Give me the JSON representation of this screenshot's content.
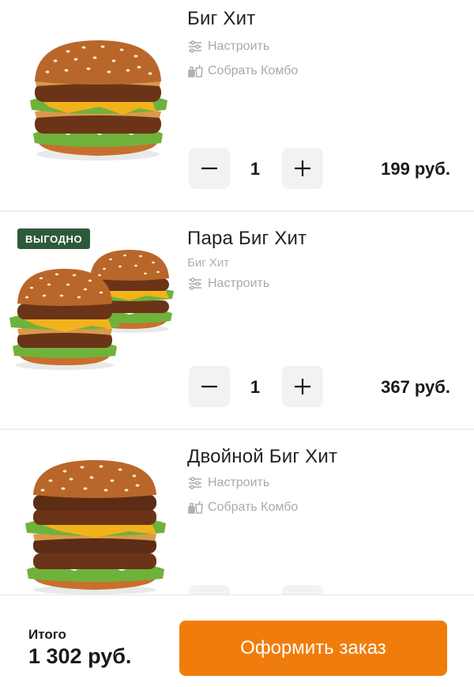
{
  "items": [
    {
      "title": "Биг Хит",
      "subtitle": "",
      "customize_label": "Настроить",
      "combo_label": "Собрать Комбо",
      "quantity": "1",
      "price": "199 руб."
    },
    {
      "badge": "ВЫГОДНО",
      "title": "Пара Биг Хит",
      "subtitle": "Биг Хит",
      "customize_label": "Настроить",
      "quantity": "1",
      "price": "367 руб."
    },
    {
      "title": "Двойной Биг Хит",
      "customize_label": "Настроить",
      "combo_label": "Собрать Комбо"
    }
  ],
  "footer": {
    "total_label": "Итого",
    "total_value": "1 302 руб.",
    "checkout_label": "Оформить заказ"
  },
  "colors": {
    "accent": "#f07d0b",
    "badge": "#2d5a3a",
    "muted_text": "#a9a9a9",
    "stepper_bg": "#f2f2f2"
  },
  "icons": [
    "sliders-icon",
    "combo-icon",
    "minus-icon",
    "plus-icon",
    "burger-image"
  ]
}
